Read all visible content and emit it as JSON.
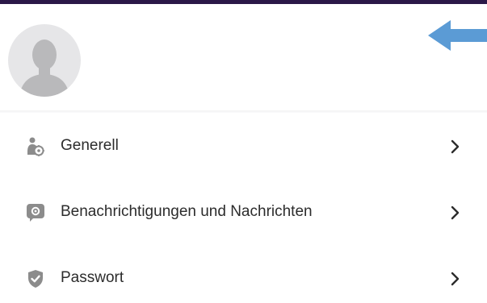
{
  "profile": {
    "avatar": "user-silhouette-icon",
    "back_icon": "arrow-left-icon"
  },
  "menu": {
    "items": [
      {
        "label": "Generell",
        "icon": "user-settings-icon"
      },
      {
        "label": "Benachrichtigungen und Nachrichten",
        "icon": "notification-settings-icon"
      },
      {
        "label": "Passwort",
        "icon": "shield-check-icon"
      }
    ]
  },
  "colors": {
    "topbar": "#2b1848",
    "accent_arrow": "#5b9bd5",
    "icon_gray": "#8c8c8c",
    "text": "#2c2c2c"
  }
}
